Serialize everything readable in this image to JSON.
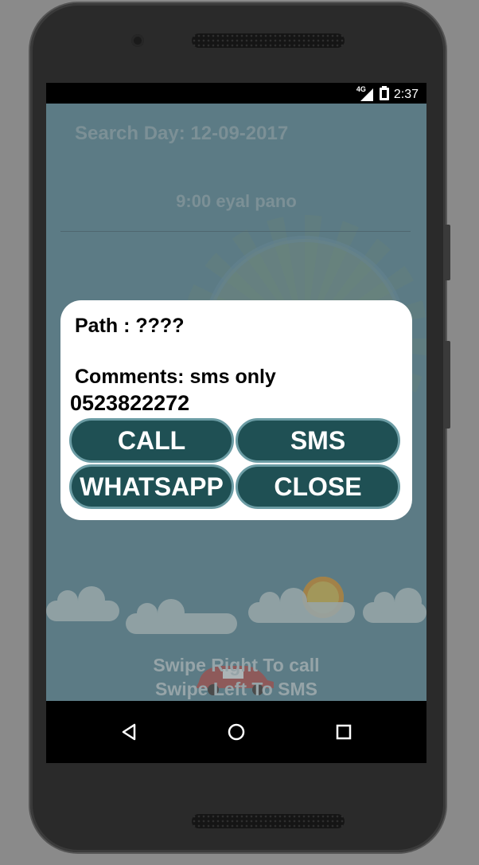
{
  "status_bar": {
    "network": "4G",
    "time": "2:37"
  },
  "background_screen": {
    "search_day": "Search Day: 12-09-2017",
    "row_text": "9:00  eyal pano",
    "swipe_right": "Swipe Right To call",
    "swipe_left": "Swipe Left To SMS"
  },
  "dialog": {
    "path": "Path : ????",
    "comments": "Comments: sms only",
    "phone": "0523822272",
    "buttons": {
      "call": "CALL",
      "sms": "SMS",
      "whatsapp": "WHATSAPP",
      "close": "CLOSE"
    }
  },
  "icons": {
    "signal": "signal-icon",
    "battery": "battery-icon",
    "back": "back-triangle-icon",
    "home": "home-circle-icon",
    "recents": "recents-square-icon"
  },
  "colors": {
    "button_bg": "#1f5054",
    "button_border": "#6b9ca4",
    "app_bg": "#4d7d8c"
  }
}
